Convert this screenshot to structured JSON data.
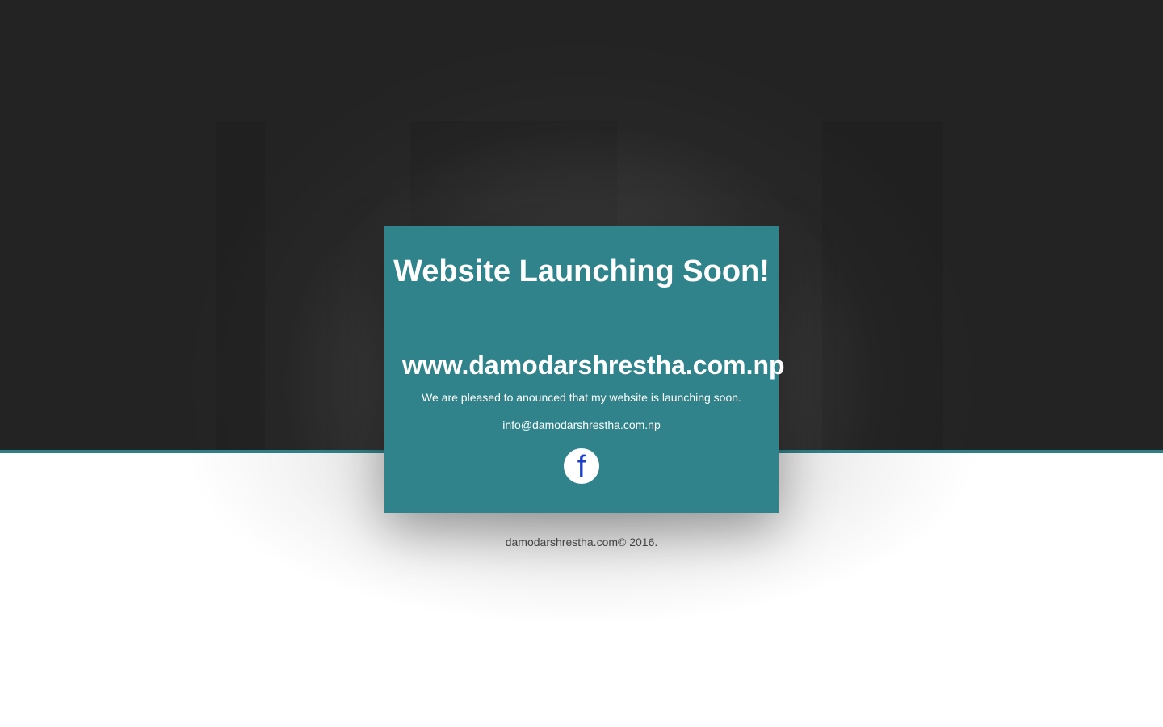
{
  "hero": {
    "headline": "Website Launching Soon!",
    "domain": "www.damodarshrestha.com.np",
    "announcement": "We are pleased to anounced that my website is launching soon.",
    "email": "info@damodarshrestha.com.np"
  },
  "social": {
    "facebook_icon": "facebook-icon",
    "facebook_glyph": "f"
  },
  "footer": {
    "copyright": "damodarshrestha.com© 2016."
  },
  "colors": {
    "top_background": "#232323",
    "accent_teal": "#30838a",
    "divider_teal": "#2e7f87",
    "page_background": "#ffffff",
    "facebook_blue": "#1e3fbf",
    "footer_text": "#444444"
  }
}
